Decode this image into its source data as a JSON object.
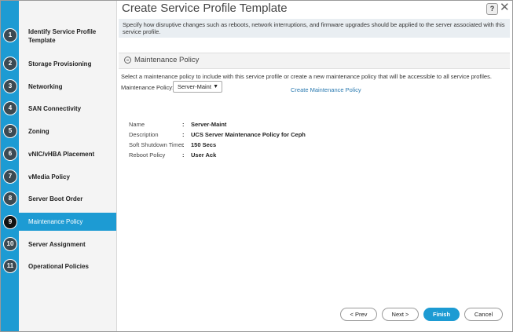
{
  "window": {
    "title": "Create Service Profile Template",
    "help_label": "?",
    "close_label": "✕"
  },
  "steps": [
    {
      "num": "1",
      "label": "Identify Service Profile Template"
    },
    {
      "num": "2",
      "label": "Storage Provisioning"
    },
    {
      "num": "3",
      "label": "Networking"
    },
    {
      "num": "4",
      "label": "SAN Connectivity"
    },
    {
      "num": "5",
      "label": "Zoning"
    },
    {
      "num": "6",
      "label": "vNIC/vHBA Placement"
    },
    {
      "num": "7",
      "label": "vMedia Policy"
    },
    {
      "num": "8",
      "label": "Server Boot Order"
    },
    {
      "num": "9",
      "label": "Maintenance Policy"
    },
    {
      "num": "10",
      "label": "Server Assignment"
    },
    {
      "num": "11",
      "label": "Operational Policies"
    }
  ],
  "active_step": "9",
  "intro": "Specify how disruptive changes such as reboots, network interruptions, and firmware upgrades should be applied to the server associated with this service profile.",
  "section": {
    "title": "Maintenance Policy",
    "description": "Select a maintenance policy to include with this service profile or create a new maintenance policy that will be accessible to all service profiles.",
    "policy_label": "Maintenance Policy:",
    "policy_value": "Server-Maint",
    "create_link": "Create Maintenance Policy"
  },
  "details": [
    {
      "key": "Name",
      "value": "Server-Maint"
    },
    {
      "key": "Description",
      "value": "UCS Server Maintenance Policy for Ceph"
    },
    {
      "key": "Soft Shutdown Timer",
      "value": "150 Secs"
    },
    {
      "key": "Reboot Policy",
      "value": "User Ack"
    }
  ],
  "footer": {
    "prev": "< Prev",
    "next": "Next >",
    "finish": "Finish",
    "cancel": "Cancel"
  },
  "colors": {
    "accent": "#1d9bd3",
    "step_circle": "#3c4a52"
  }
}
